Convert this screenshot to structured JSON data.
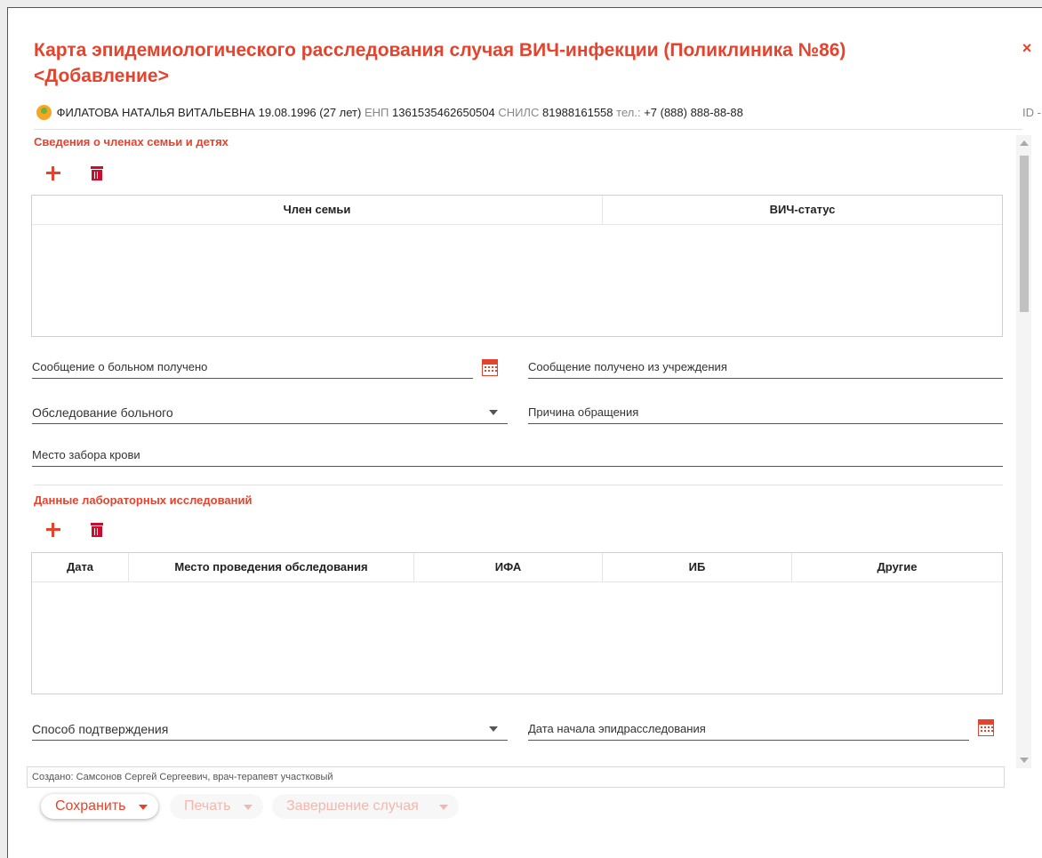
{
  "dialog": {
    "title": "Карта эпидемиологического расследования случая ВИЧ-инфекции (Поликлиника №86) <Добавление>",
    "close_icon": "×"
  },
  "patient": {
    "name": "ФИЛАТОВА НАТАЛЬЯ ВИТАЛЬЕВНА",
    "birth": "19.08.1996 (27 лет)",
    "enp_label": "ЕНП",
    "enp": "1361535462650504",
    "snils_label": "СНИЛС",
    "snils": "81988161558",
    "phone_label": "тел.:",
    "phone": "+7 (888) 888-88-88",
    "id_label": "ID -"
  },
  "family": {
    "title": "Сведения о членах семьи и детях",
    "columns": [
      "Член семьи",
      "ВИЧ-статус"
    ]
  },
  "fields": {
    "report_received": "Сообщение о больном получено",
    "report_from_institution": "Сообщение получено из учреждения",
    "examination": "Обследование больного",
    "reason": "Причина обращения",
    "blood_place": "Место забора крови",
    "confirmation_method": "Способ подтверждения",
    "investigation_start": "Дата начала эпидрасследования"
  },
  "lab": {
    "title": "Данные лабораторных исследований",
    "columns": [
      "Дата",
      "Место проведения обследования",
      "ИФА",
      "ИБ",
      "Другие"
    ]
  },
  "footer": {
    "created": "Создано:  Самсонов Сергей Сергеевич, врач-терапевт участковый",
    "save": "Сохранить",
    "print": "Печать",
    "complete": "Завершение случая"
  },
  "colors": {
    "accent": "#e5432d",
    "trash": "#c8102e"
  }
}
